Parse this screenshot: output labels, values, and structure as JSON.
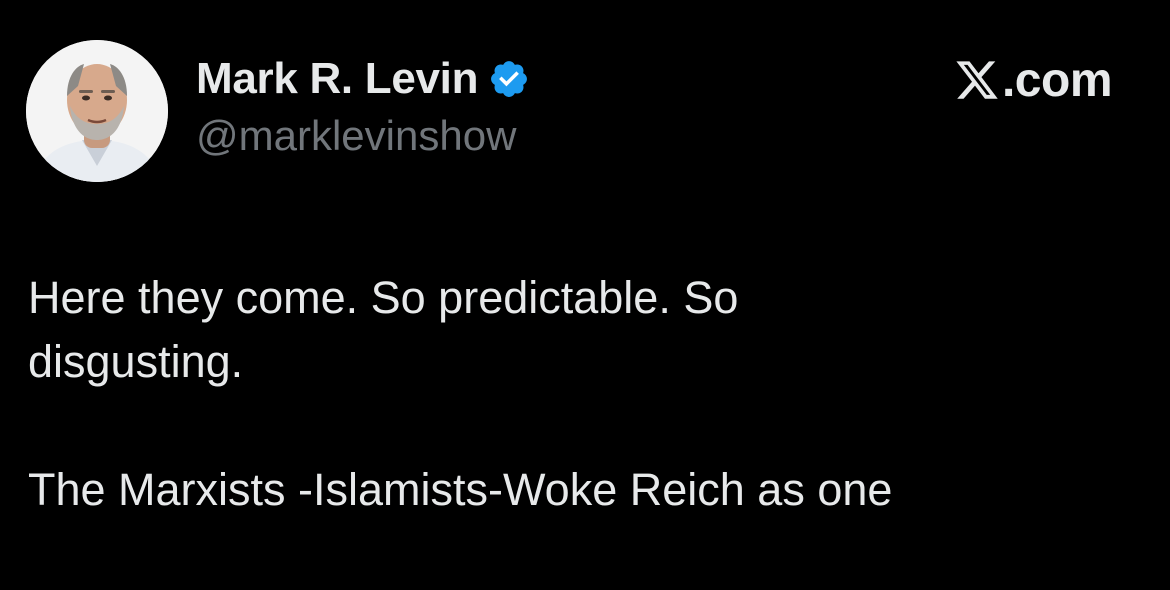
{
  "author": {
    "name": "Mark R. Levin",
    "handle": "@marklevinshow",
    "verified": true,
    "verified_badge_color": "#1d9bf0"
  },
  "brand": {
    "domain": ".com",
    "icon": "x-logo-icon"
  },
  "tweet": {
    "lines": [
      "Here they come. So predictable. So",
      "disgusting.",
      "",
      "The Marxists -Islamists-Woke Reich as one"
    ]
  },
  "colors": {
    "background": "#000000",
    "text_primary": "#e7e9ea",
    "text_secondary": "#71767b"
  }
}
